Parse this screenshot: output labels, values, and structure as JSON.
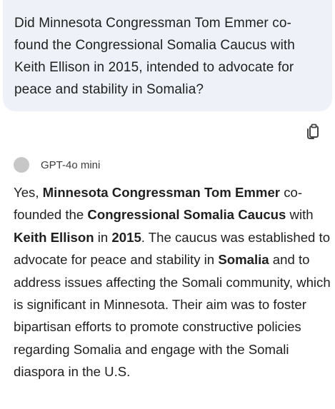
{
  "question": {
    "text": "Did Minnesota Congressman Tom Emmer co-found the Congressional Somalia Caucus with Keith Ellison in 2015, intended to advocate for peace and stability in Somalia?"
  },
  "actions": {
    "copy_icon": "copy-icon"
  },
  "model": {
    "name": "GPT-4o mini"
  },
  "answer": {
    "segments": [
      {
        "text": "Yes, ",
        "bold": false
      },
      {
        "text": "Minnesota Congressman Tom Emmer",
        "bold": true
      },
      {
        "text": " co-founded the ",
        "bold": false
      },
      {
        "text": "Congressional Somalia Caucus",
        "bold": true
      },
      {
        "text": " with ",
        "bold": false
      },
      {
        "text": "Keith Ellison",
        "bold": true
      },
      {
        "text": " in ",
        "bold": false
      },
      {
        "text": "2015",
        "bold": true
      },
      {
        "text": ". The caucus was established to advocate for peace and stability in ",
        "bold": false
      },
      {
        "text": "Somalia",
        "bold": true
      },
      {
        "text": " and to address issues affecting the Somali community, which is significant in Minnesota. Their aim was to foster bipartisan efforts to promote constructive policies regarding Somalia and engage with the Somali diaspora in the U.S.",
        "bold": false
      }
    ]
  },
  "colors": {
    "bubble_bg": "#eef2f8",
    "text": "#1f1f1f",
    "model_dot": "#c7c7c7"
  }
}
